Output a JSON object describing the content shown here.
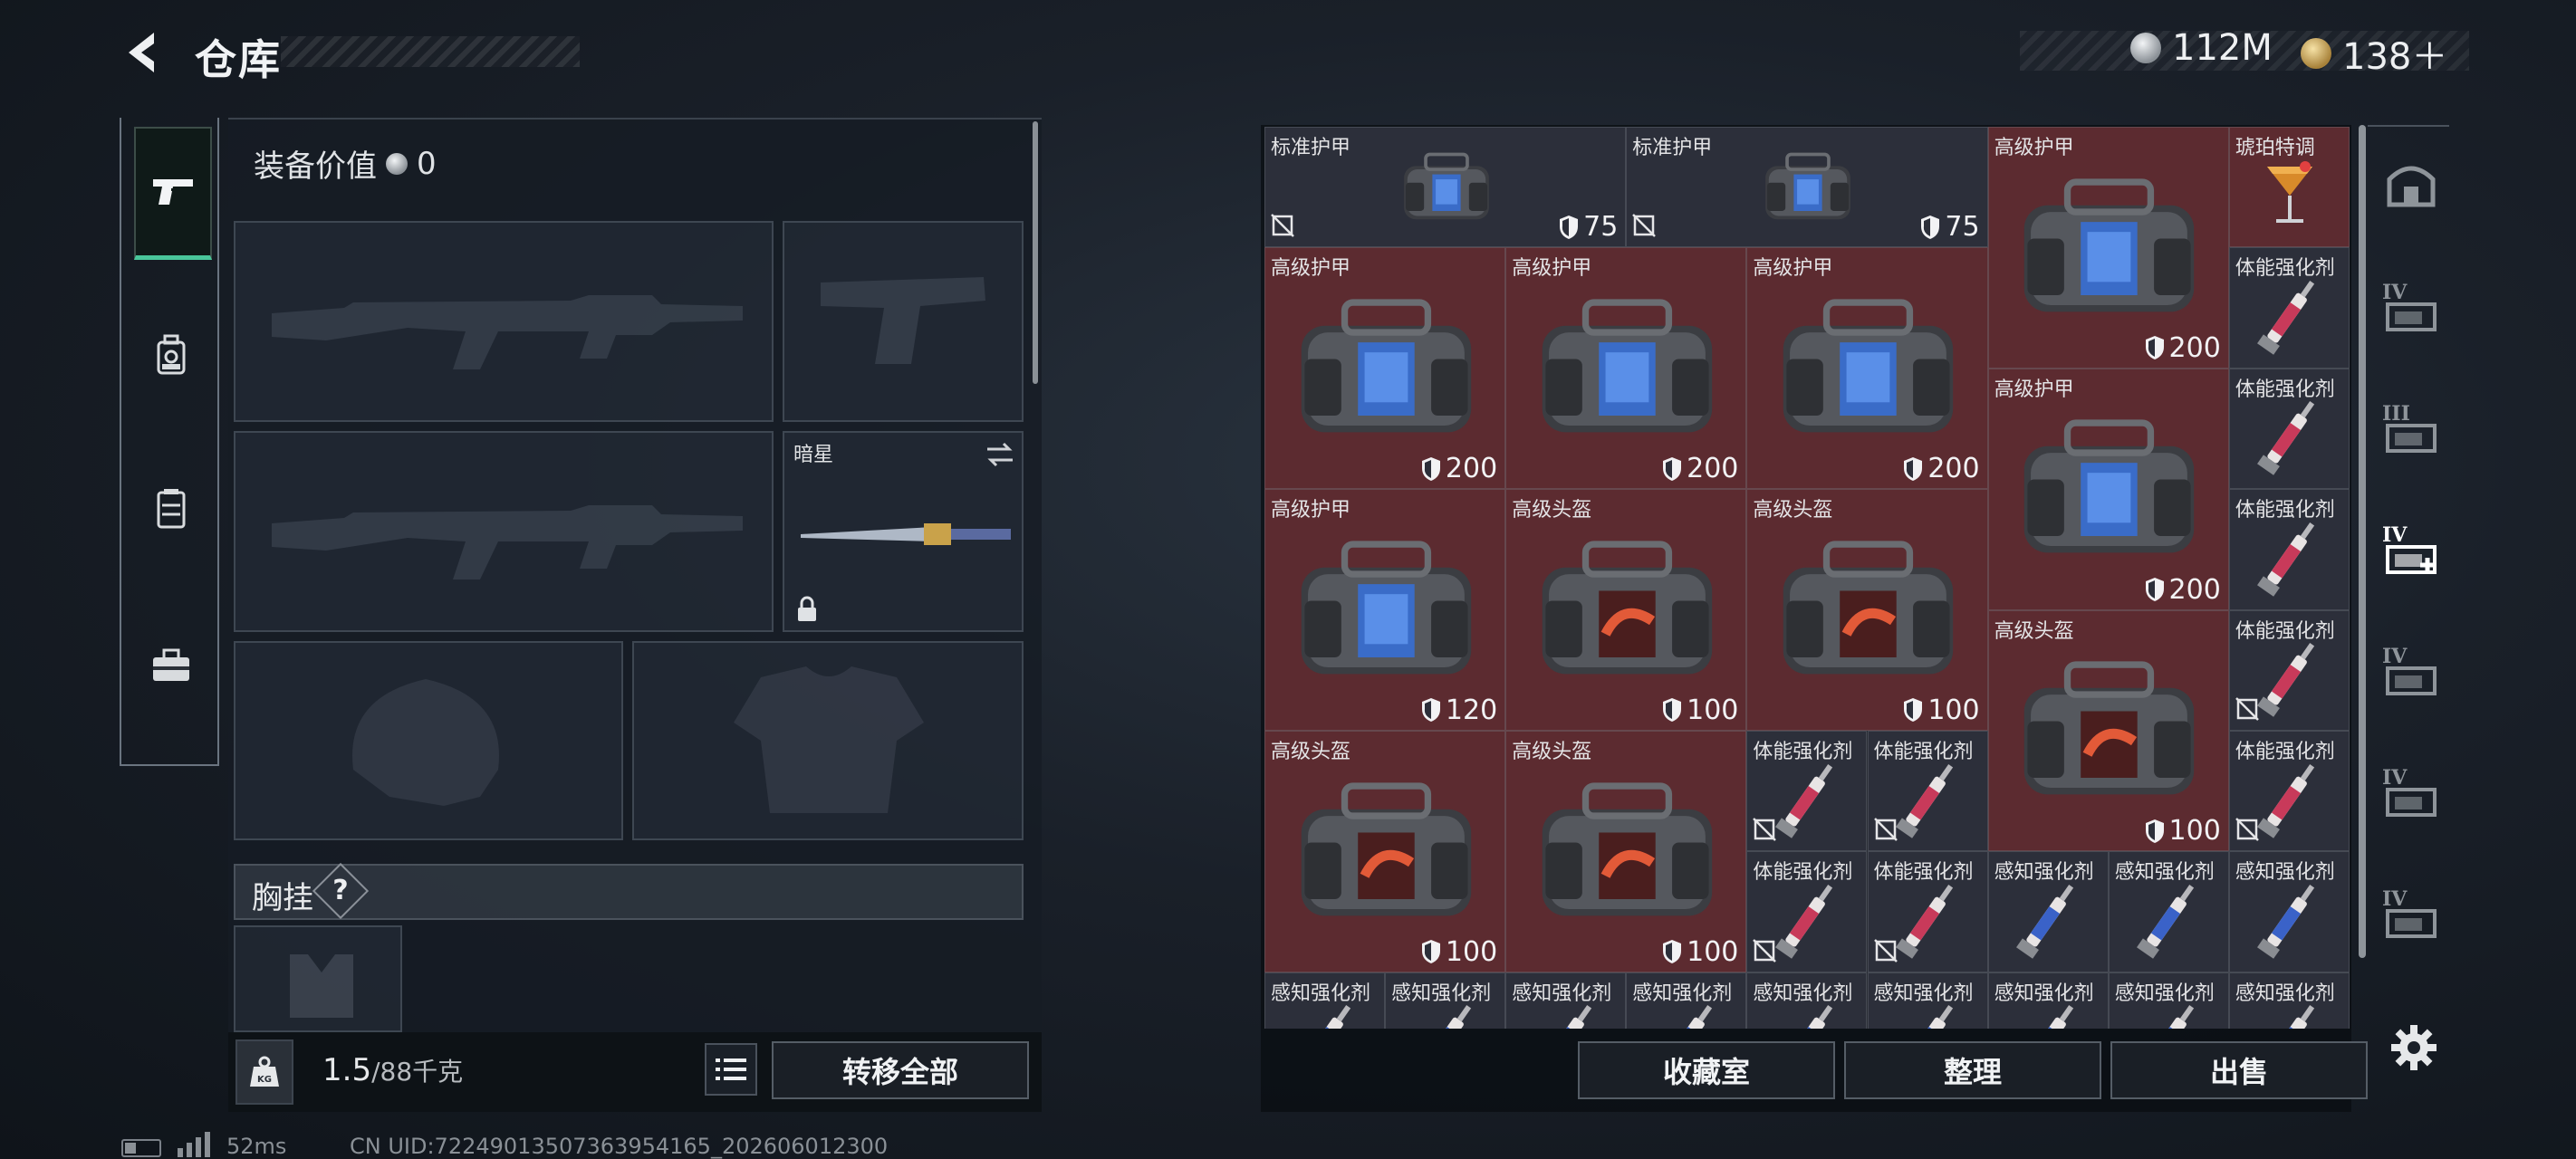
{
  "header": {
    "title": "仓库",
    "currency": [
      {
        "icon": "silver-coin-icon",
        "value": "112M",
        "color": "#c9cdd2"
      },
      {
        "icon": "gold-coin-icon",
        "value": "138＋",
        "color": "#d9b25a"
      }
    ]
  },
  "rail": [
    {
      "icon": "pistol-icon",
      "active": true
    },
    {
      "icon": "backpack-icon",
      "active": false
    },
    {
      "icon": "vest-icon",
      "active": false
    },
    {
      "icon": "toolbox-icon",
      "active": false
    }
  ],
  "equipment": {
    "value_label": "装备价值",
    "value": "0",
    "melee_name": "暗星",
    "chest_label": "胸挂",
    "chest_help": "?"
  },
  "bottom_left": {
    "weight_current": "1.5",
    "weight_max": "/88千克",
    "transfer_all": "转移全部"
  },
  "grid": {
    "columns": 9,
    "items": [
      {
        "name": "标准护甲",
        "col": 0,
        "row": 0,
        "w": 3,
        "h": 1,
        "kind": "armor",
        "theme": "dark",
        "durability": "75",
        "uninsured": true
      },
      {
        "name": "标准护甲",
        "col": 3,
        "row": 0,
        "w": 3,
        "h": 1,
        "kind": "armor",
        "theme": "dark",
        "durability": "75",
        "uninsured": true
      },
      {
        "name": "高级护甲",
        "col": 6,
        "row": 0,
        "w": 2,
        "h": 2,
        "kind": "armor",
        "theme": "red",
        "durability": "200"
      },
      {
        "name": "琥珀特调",
        "col": 8,
        "row": 0,
        "w": 1,
        "h": 1,
        "kind": "drink",
        "theme": "red"
      },
      {
        "name": "高级护甲",
        "col": 0,
        "row": 1,
        "w": 2,
        "h": 2,
        "kind": "armor",
        "theme": "red",
        "durability": "200"
      },
      {
        "name": "高级护甲",
        "col": 2,
        "row": 1,
        "w": 2,
        "h": 2,
        "kind": "armor",
        "theme": "red",
        "durability": "200"
      },
      {
        "name": "高级护甲",
        "col": 4,
        "row": 1,
        "w": 2,
        "h": 2,
        "kind": "armor",
        "theme": "red",
        "durability": "200"
      },
      {
        "name": "体能强化剂",
        "col": 8,
        "row": 1,
        "w": 1,
        "h": 1,
        "kind": "syringe-red",
        "theme": "dark"
      },
      {
        "name": "高级护甲",
        "col": 6,
        "row": 2,
        "w": 2,
        "h": 2,
        "kind": "armor",
        "theme": "red",
        "durability": "200"
      },
      {
        "name": "体能强化剂",
        "col": 8,
        "row": 2,
        "w": 1,
        "h": 1,
        "kind": "syringe-red",
        "theme": "dark"
      },
      {
        "name": "高级护甲",
        "col": 0,
        "row": 3,
        "w": 2,
        "h": 2,
        "kind": "armor",
        "theme": "red",
        "durability": "120"
      },
      {
        "name": "高级头盔",
        "col": 2,
        "row": 3,
        "w": 2,
        "h": 2,
        "kind": "helmet",
        "theme": "red",
        "durability": "100"
      },
      {
        "name": "高级头盔",
        "col": 4,
        "row": 3,
        "w": 2,
        "h": 2,
        "kind": "helmet",
        "theme": "red",
        "durability": "100"
      },
      {
        "name": "体能强化剂",
        "col": 8,
        "row": 3,
        "w": 1,
        "h": 1,
        "kind": "syringe-red",
        "theme": "dark"
      },
      {
        "name": "高级头盔",
        "col": 6,
        "row": 4,
        "w": 2,
        "h": 2,
        "kind": "helmet",
        "theme": "red",
        "durability": "100"
      },
      {
        "name": "体能强化剂",
        "col": 8,
        "row": 4,
        "w": 1,
        "h": 1,
        "kind": "syringe-red",
        "theme": "dark",
        "uninsured": true
      },
      {
        "name": "高级头盔",
        "col": 0,
        "row": 5,
        "w": 2,
        "h": 2,
        "kind": "helmet",
        "theme": "red",
        "durability": "100"
      },
      {
        "name": "高级头盔",
        "col": 2,
        "row": 5,
        "w": 2,
        "h": 2,
        "kind": "helmet",
        "theme": "red",
        "durability": "100"
      },
      {
        "name": "体能强化剂",
        "col": 4,
        "row": 5,
        "w": 1,
        "h": 1,
        "kind": "syringe-red",
        "theme": "dark",
        "uninsured": true
      },
      {
        "name": "体能强化剂",
        "col": 5,
        "row": 5,
        "w": 1,
        "h": 1,
        "kind": "syringe-red",
        "theme": "dark",
        "uninsured": true
      },
      {
        "name": "体能强化剂",
        "col": 8,
        "row": 5,
        "w": 1,
        "h": 1,
        "kind": "syringe-red",
        "theme": "dark",
        "uninsured": true
      },
      {
        "name": "体能强化剂",
        "col": 4,
        "row": 6,
        "w": 1,
        "h": 1,
        "kind": "syringe-red",
        "theme": "dark",
        "uninsured": true
      },
      {
        "name": "体能强化剂",
        "col": 5,
        "row": 6,
        "w": 1,
        "h": 1,
        "kind": "syringe-red",
        "theme": "dark",
        "uninsured": true
      },
      {
        "name": "感知强化剂",
        "col": 6,
        "row": 6,
        "w": 1,
        "h": 1,
        "kind": "syringe-blue",
        "theme": "dark"
      },
      {
        "name": "感知强化剂",
        "col": 7,
        "row": 6,
        "w": 1,
        "h": 1,
        "kind": "syringe-blue",
        "theme": "dark"
      },
      {
        "name": "感知强化剂",
        "col": 8,
        "row": 6,
        "w": 1,
        "h": 1,
        "kind": "syringe-blue",
        "theme": "dark"
      },
      {
        "name": "感知强化剂",
        "col": 0,
        "row": 7,
        "w": 1,
        "h": 1,
        "kind": "syringe-blue",
        "theme": "dark"
      },
      {
        "name": "感知强化剂",
        "col": 1,
        "row": 7,
        "w": 1,
        "h": 1,
        "kind": "syringe-blue",
        "theme": "dark"
      },
      {
        "name": "感知强化剂",
        "col": 2,
        "row": 7,
        "w": 1,
        "h": 1,
        "kind": "syringe-blue",
        "theme": "dark"
      },
      {
        "name": "感知强化剂",
        "col": 3,
        "row": 7,
        "w": 1,
        "h": 1,
        "kind": "syringe-blue",
        "theme": "dark"
      },
      {
        "name": "感知强化剂",
        "col": 4,
        "row": 7,
        "w": 1,
        "h": 1,
        "kind": "syringe-blue",
        "theme": "dark"
      },
      {
        "name": "感知强化剂",
        "col": 5,
        "row": 7,
        "w": 1,
        "h": 1,
        "kind": "syringe-blue",
        "theme": "dark"
      },
      {
        "name": "感知强化剂",
        "col": 6,
        "row": 7,
        "w": 1,
        "h": 1,
        "kind": "syringe-blue",
        "theme": "dark"
      },
      {
        "name": "感知强化剂",
        "col": 7,
        "row": 7,
        "w": 1,
        "h": 1,
        "kind": "syringe-blue",
        "theme": "dark"
      },
      {
        "name": "感知强化剂",
        "col": 8,
        "row": 7,
        "w": 1,
        "h": 1,
        "kind": "syringe-blue",
        "theme": "dark"
      }
    ]
  },
  "right_rail": [
    {
      "icon": "safe-box-icon",
      "label": ""
    },
    {
      "icon": "storage-tier-icon",
      "label": "IV"
    },
    {
      "icon": "storage-tier-icon",
      "label": "III"
    },
    {
      "icon": "storage-medical-icon",
      "label": "IV",
      "active": true
    },
    {
      "icon": "storage-tier-icon",
      "label": "IV"
    },
    {
      "icon": "storage-tier-icon",
      "label": "IV"
    },
    {
      "icon": "storage-tier-icon",
      "label": "IV"
    }
  ],
  "actions": {
    "collection": "收藏室",
    "sort": "整理",
    "sell": "出售"
  },
  "status": {
    "ping": "52ms",
    "uid": "CN UID:7224901350736395416​5_202606012300"
  },
  "colors": {
    "accent_green": "#49c69a",
    "cell_red": "#5c2b30",
    "cell_dark": "#2c2f3a"
  }
}
